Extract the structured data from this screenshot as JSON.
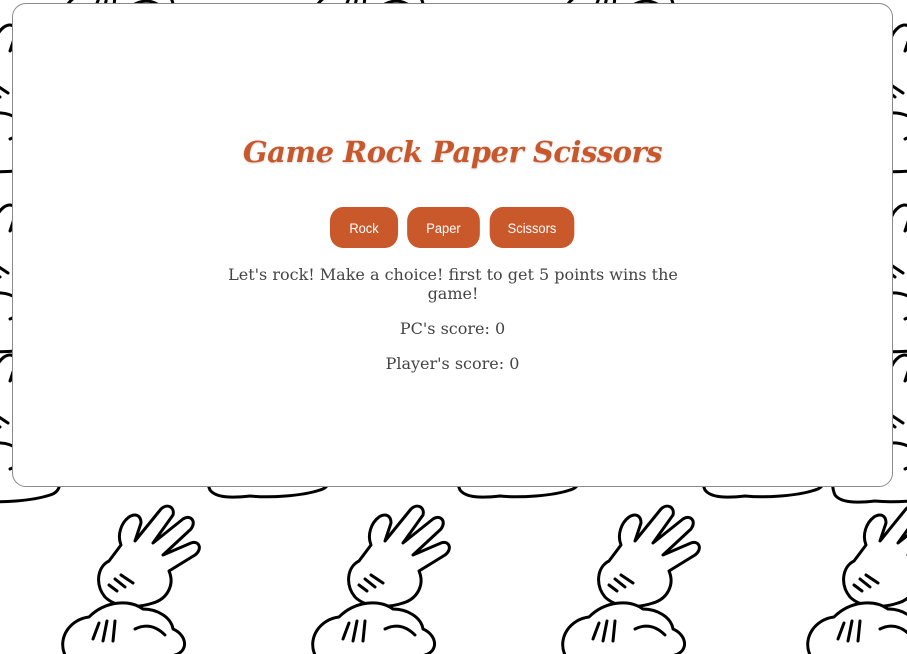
{
  "background": {
    "pattern_icon": "cartoon-hand-icon",
    "color": "#ffffff",
    "line_color": "#000000"
  },
  "game": {
    "title": "Game Rock Paper Scissors",
    "accent_color": "#c9582b",
    "buttons": {
      "rock": "Rock",
      "paper": "Paper",
      "scissors": "Scissors"
    },
    "message": "Let's rock! Make a choice! first to get 5 points wins the game!",
    "pc_score_label": "PC's score: 0",
    "player_score_label": "Player's score: 0"
  }
}
